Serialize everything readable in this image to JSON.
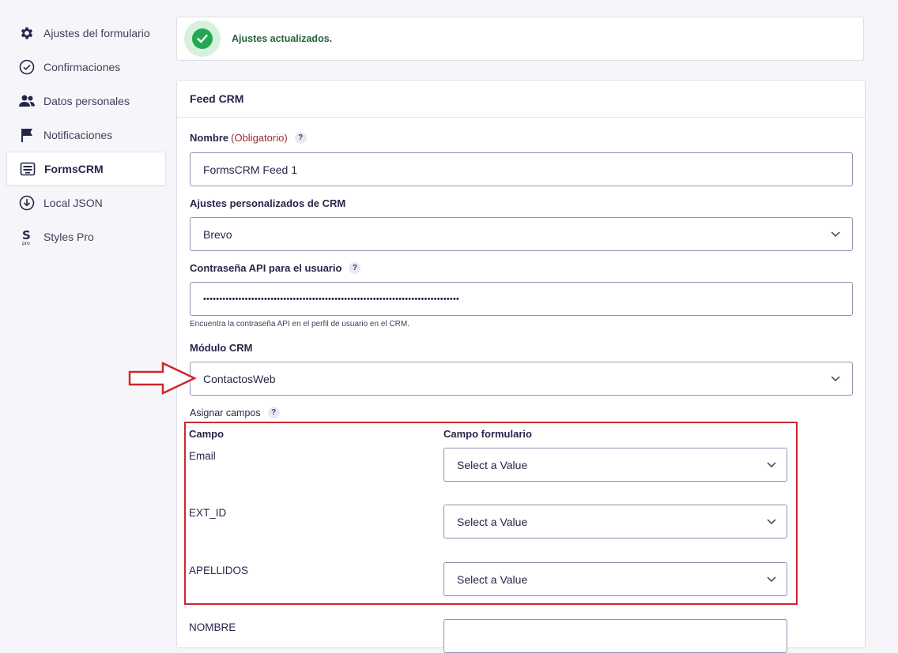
{
  "sidebar": {
    "items": [
      {
        "label": "Ajustes del formulario",
        "icon": "gear-icon"
      },
      {
        "label": "Confirmaciones",
        "icon": "check-circle-icon"
      },
      {
        "label": "Datos personales",
        "icon": "users-icon"
      },
      {
        "label": "Notificaciones",
        "icon": "flag-icon"
      },
      {
        "label": "FormsCRM",
        "icon": "forms-crm-icon",
        "active": true
      },
      {
        "label": "Local JSON",
        "icon": "download-circle-icon"
      },
      {
        "label": "Styles Pro",
        "icon": "styles-pro-icon"
      }
    ]
  },
  "notice": {
    "message": "Ajustes actualizados.",
    "color": "#22a753"
  },
  "feed": {
    "title": "Feed CRM",
    "name_label": "Nombre",
    "name_required": "(Obligatorio)",
    "name_value": "FormsCRM Feed 1",
    "crm_label": "Ajustes personalizados de CRM",
    "crm_value": "Brevo",
    "api_label": "Contraseña API para el usuario",
    "api_value": "••••••••••••••••••••••••••••••••••••••••••••••••••••••••••••••••••••••••••••••••",
    "api_hint": "Encuentra la contraseña API en el perfil de usuario en el CRM.",
    "module_label": "Módulo CRM",
    "module_value": "ContactosWeb",
    "map_label": "Asignar campos",
    "help_glyph": "?"
  },
  "mapping": {
    "col_field": "Campo",
    "col_form_field": "Campo formulario",
    "rows": [
      {
        "field": "Email",
        "value": "Select a Value"
      },
      {
        "field": "EXT_ID",
        "value": "Select a Value"
      },
      {
        "field": "APELLIDOS",
        "value": "Select a Value"
      },
      {
        "field": "NOMBRE",
        "value": ""
      }
    ]
  },
  "annotation": {
    "highlight_color": "#d0262e"
  }
}
